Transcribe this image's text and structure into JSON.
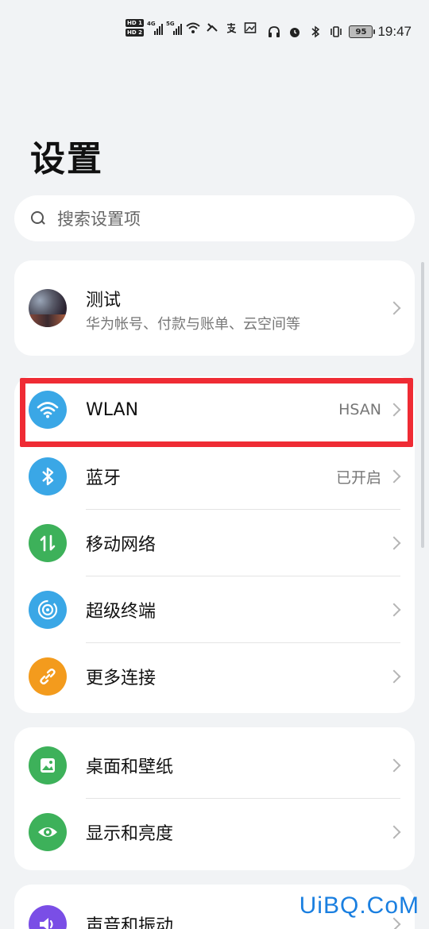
{
  "status_bar": {
    "hd1": "HD 1",
    "hd2": "HD 2",
    "net1": "4G",
    "net2": "5G",
    "battery": "95",
    "time": "19:47"
  },
  "page": {
    "title": "设置"
  },
  "search": {
    "placeholder": "搜索设置项"
  },
  "account": {
    "name": "测试",
    "subtitle": "华为帐号、付款与账单、云空间等"
  },
  "connectivity": [
    {
      "label": "WLAN",
      "value": "HSAN",
      "icon": "wifi-icon",
      "color": "#3aa7e6"
    },
    {
      "label": "蓝牙",
      "value": "已开启",
      "icon": "bluetooth-icon",
      "color": "#3aa7e6"
    },
    {
      "label": "移动网络",
      "value": "",
      "icon": "mobile-network-icon",
      "color": "#3db15a"
    },
    {
      "label": "超级终端",
      "value": "",
      "icon": "super-device-icon",
      "color": "#3aa7e6"
    },
    {
      "label": "更多连接",
      "value": "",
      "icon": "link-icon",
      "color": "#f39b1d"
    }
  ],
  "display": [
    {
      "label": "桌面和壁纸",
      "icon": "wallpaper-icon",
      "color": "#3db15a"
    },
    {
      "label": "显示和亮度",
      "icon": "eye-icon",
      "color": "#3db15a"
    }
  ],
  "sound": [
    {
      "label": "声音和振动",
      "icon": "speaker-icon",
      "color": "#7a4ee6"
    }
  ],
  "watermark": "UiBQ.CoM",
  "colors": {
    "highlight": "#ef2b34",
    "background": "#f1f3f5"
  }
}
